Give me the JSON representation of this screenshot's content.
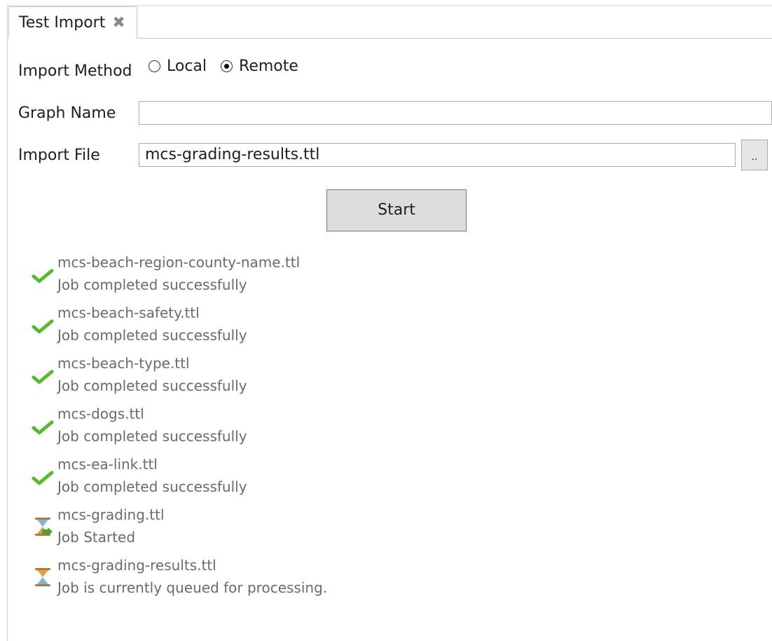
{
  "tab": {
    "title": "Test Import",
    "close_glyph": "✖"
  },
  "form": {
    "import_method_label": "Import Method",
    "methods": [
      {
        "label": "Local",
        "selected": false
      },
      {
        "label": "Remote",
        "selected": true
      }
    ],
    "graph_name_label": "Graph Name",
    "graph_name_value": "",
    "import_file_label": "Import File",
    "import_file_value": "mcs-grading-results.ttl",
    "browse_label": "..",
    "start_label": "Start"
  },
  "jobs": [
    {
      "file": "mcs-beach-region-county-name.ttl",
      "status": "Job completed successfully",
      "icon": "check-icon"
    },
    {
      "file": "mcs-beach-safety.ttl",
      "status": "Job completed successfully",
      "icon": "check-icon"
    },
    {
      "file": "mcs-beach-type.ttl",
      "status": "Job completed successfully",
      "icon": "check-icon"
    },
    {
      "file": "mcs-dogs.ttl",
      "status": "Job completed successfully",
      "icon": "check-icon"
    },
    {
      "file": "mcs-ea-link.ttl",
      "status": "Job completed successfully",
      "icon": "check-icon"
    },
    {
      "file": "mcs-grading.ttl",
      "status": "Job Started",
      "icon": "hourglass-started-icon"
    },
    {
      "file": "mcs-grading-results.ttl",
      "status": "Job is currently queued for processing.",
      "icon": "hourglass-icon"
    }
  ],
  "colors": {
    "check": "#5cb82e",
    "hourglass_sand": "#e0a24a",
    "hourglass_glass": "#7fb3e3",
    "arrow": "#4aa02c"
  }
}
